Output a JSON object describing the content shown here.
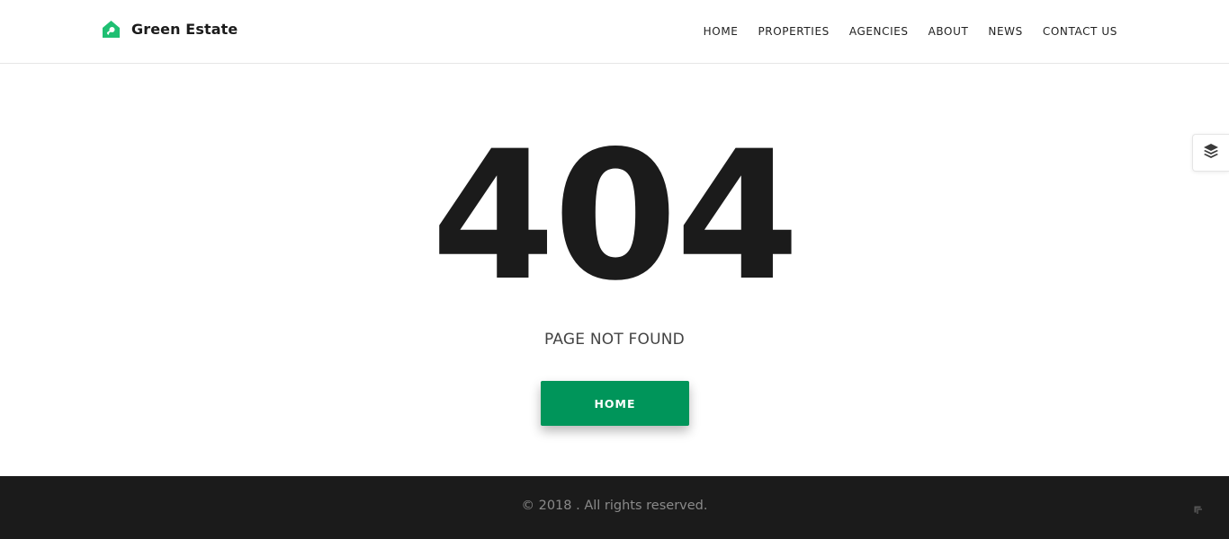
{
  "brand": {
    "name": "Green Estate",
    "icon": "house-key-icon",
    "accent_color": "#1fbf72"
  },
  "nav": {
    "items": [
      {
        "label": "HOME"
      },
      {
        "label": "PROPERTIES"
      },
      {
        "label": "AGENCIES"
      },
      {
        "label": "ABOUT"
      },
      {
        "label": "NEWS"
      },
      {
        "label": "CONTACT US"
      }
    ]
  },
  "side_tab": {
    "icon": "layers-icon"
  },
  "error": {
    "code": "404",
    "message": "PAGE NOT FOUND",
    "button_label": "HOME",
    "button_color": "#00955a"
  },
  "footer": {
    "copyright": "© 2018 . All rights reserved.",
    "background": "#1b1b1b",
    "scroll_icon": "scroll-top-icon"
  }
}
